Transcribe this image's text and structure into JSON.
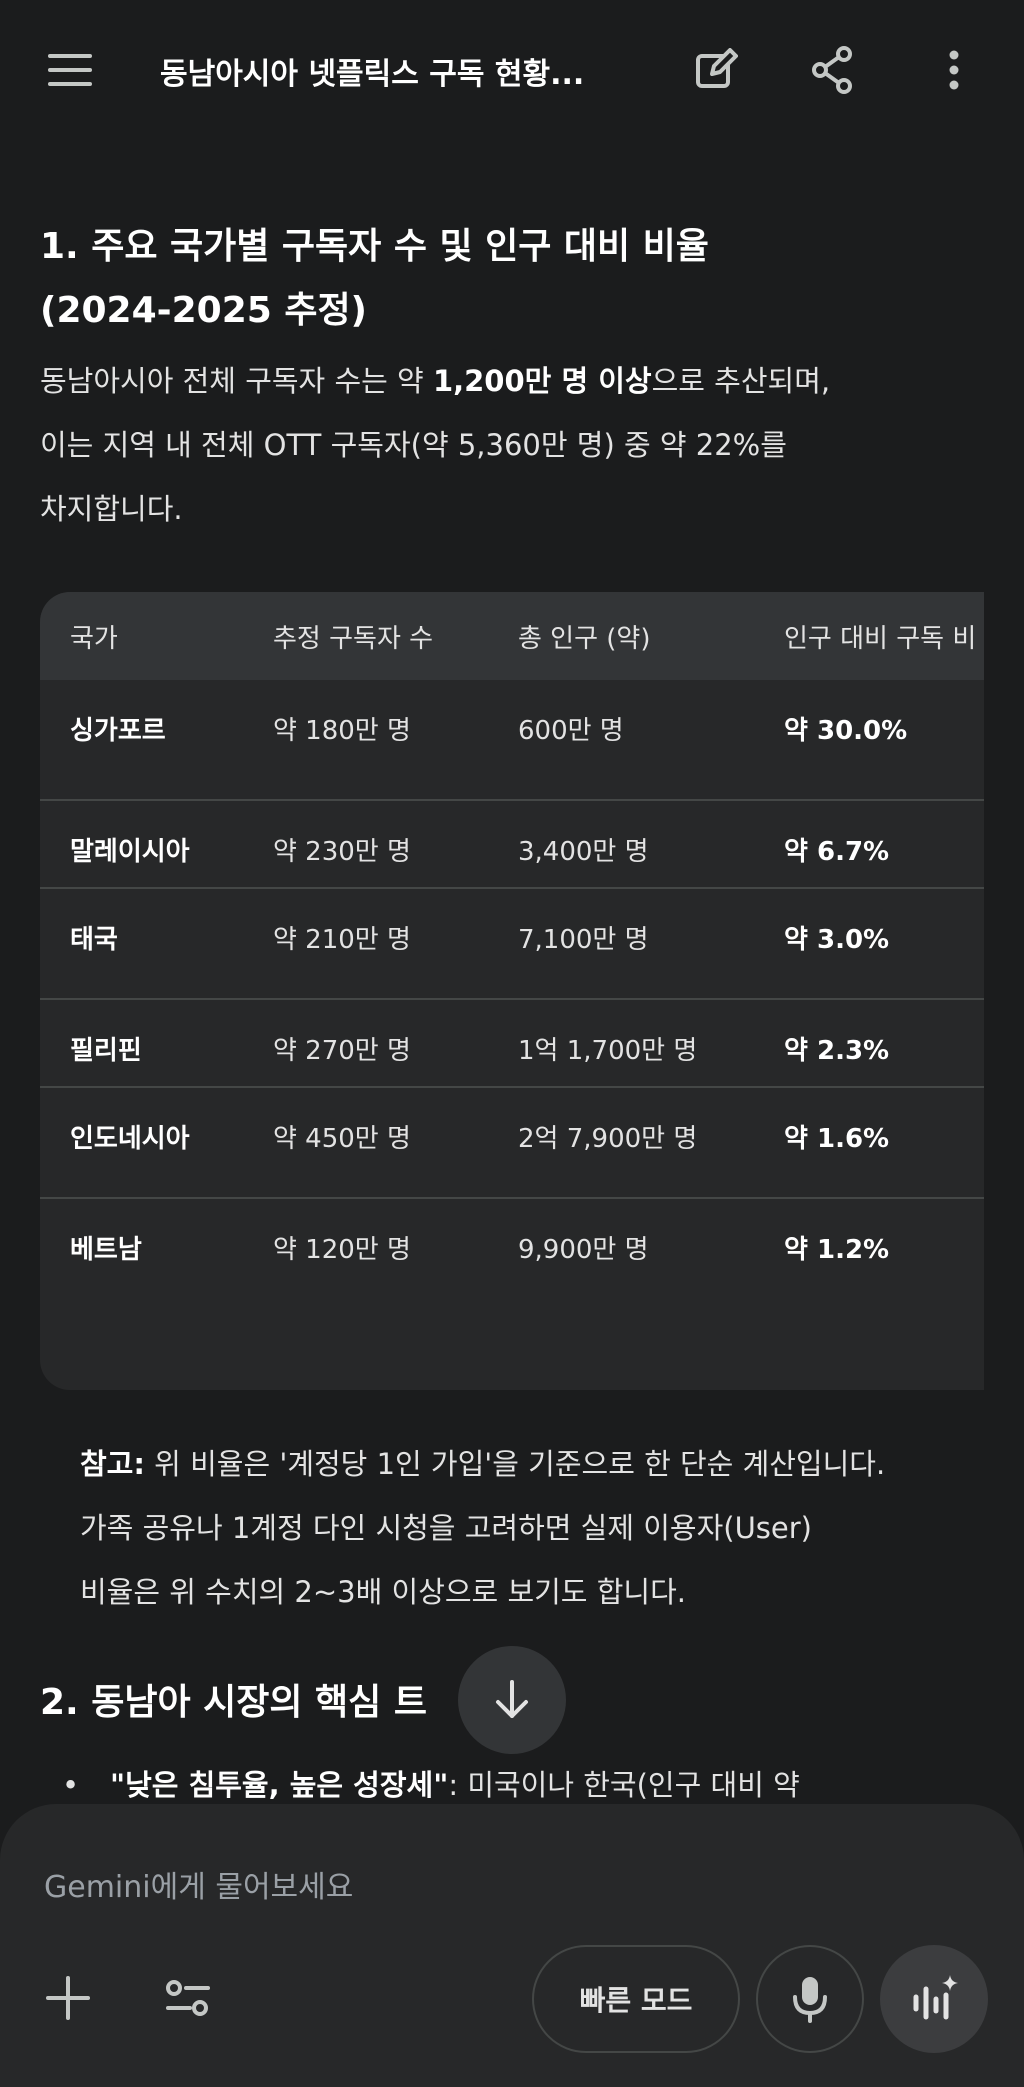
{
  "header": {
    "title": "동남아시아 넷플릭스 구독 현황...",
    "menu_icon": "menu-icon",
    "edit_icon": "edit-icon",
    "share_icon": "share-icon",
    "more_icon": "more-vert-icon"
  },
  "section1": {
    "heading_line1": "1. 주요 국가별 구독자 수 및 인구 대비 비율",
    "heading_line2": "(2024-2025 추정)",
    "intro_l1_pre": "동남아시아 전체 구독자 수는 약 ",
    "intro_l1_bold": "1,200만 명 이상",
    "intro_l1_post": "으로 추산되며,",
    "intro_l2": "이는 지역 내 전체 OTT 구독자(약 5,360만 명) 중 약 22%를",
    "intro_l3": "차지합니다."
  },
  "table": {
    "headers": [
      "국가",
      "추정 구독자 수",
      "총 인구 (약)",
      "인구 대비 구독 비"
    ],
    "rows": [
      {
        "country": "싱가포르",
        "subscribers": "약 180만 명",
        "population": "600만 명",
        "ratio": "약 30.0%"
      },
      {
        "country": "말레이시아",
        "subscribers": "약 230만 명",
        "population": "3,400만 명",
        "ratio": "약 6.7%"
      },
      {
        "country": "태국",
        "subscribers": "약 210만 명",
        "population": "7,100만 명",
        "ratio": "약 3.0%"
      },
      {
        "country": "필리핀",
        "subscribers": "약 270만 명",
        "population": "1억 1,700만 명",
        "ratio": "약 2.3%"
      },
      {
        "country": "인도네시아",
        "subscribers": "약 450만 명",
        "population": "2억 7,900만 명",
        "ratio": "약 1.6%"
      },
      {
        "country": "베트남",
        "subscribers": "약 120만 명",
        "population": "9,900만 명",
        "ratio": "약 1.2%"
      }
    ]
  },
  "note": {
    "label": "참고:",
    "l1": " 위 비율은 '계정당 1인 가입'을 기준으로 한 단순 계산입니다.",
    "l2": "가족 공유나 1계정 다인 시청을 고려하면 실제 이용자(User)",
    "l3": "비율은 위 수치의 2~3배 이상으로 보기도 합니다."
  },
  "section2": {
    "heading": "2. 동남아 시장의 핵심 트",
    "bullet_bold": "\"낮은 침투율, 높은 성장세\"",
    "bullet_text": ": 미국이나 한국(인구 대비 약"
  },
  "scroll_down_icon": "arrow-down-icon",
  "composer": {
    "placeholder": "Gemini에게 물어보세요",
    "fast_mode_label": "빠른 모드",
    "add_icon": "plus-icon",
    "tools_icon": "tools-icon",
    "mic_icon": "mic-icon",
    "live_icon": "live-sparkle-icon"
  }
}
